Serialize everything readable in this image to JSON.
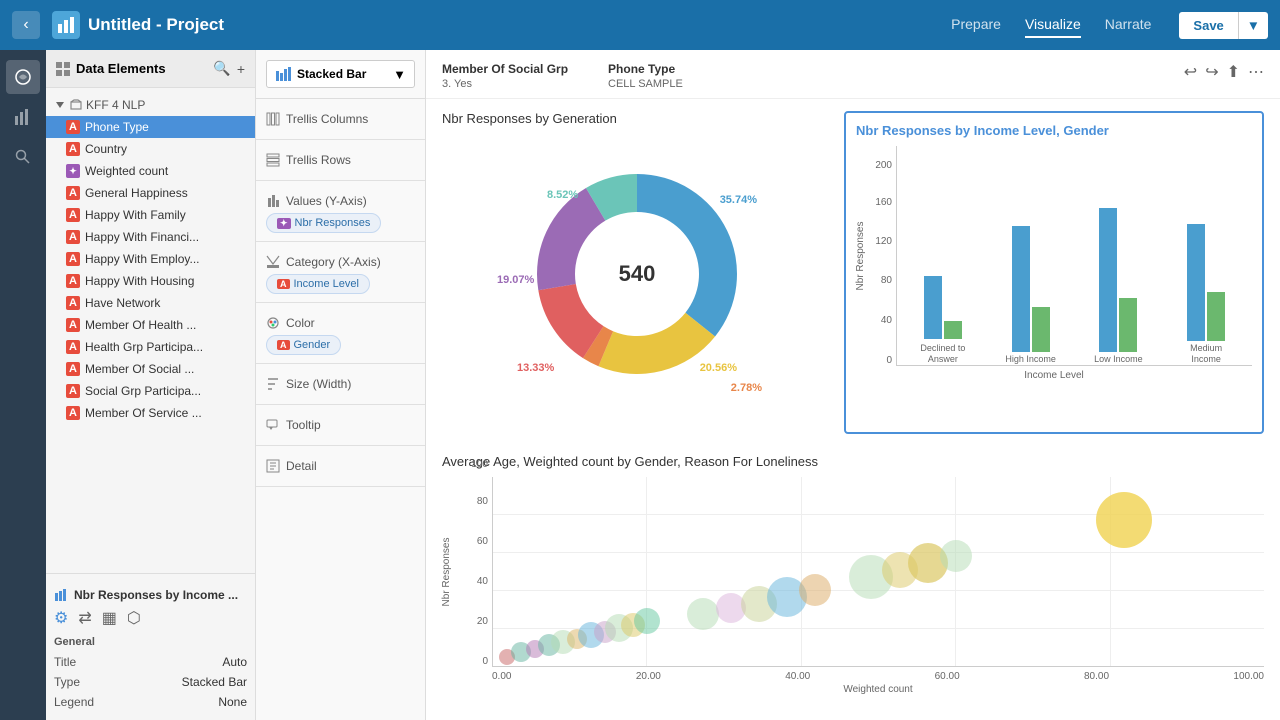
{
  "topNav": {
    "title": "Untitled - Project",
    "tabs": [
      {
        "label": "Prepare",
        "active": false
      },
      {
        "label": "Visualize",
        "active": true
      },
      {
        "label": "Narrate",
        "active": false
      }
    ],
    "saveLabel": "Save"
  },
  "dataPanel": {
    "title": "Data Elements",
    "projectName": "KFF 4 NLP",
    "items": [
      {
        "label": "Phone Type",
        "icon": "A",
        "selected": true
      },
      {
        "label": "Country",
        "icon": "A",
        "selected": false
      },
      {
        "label": "Weighted count",
        "icon": "hash",
        "selected": false
      },
      {
        "label": "General Happiness",
        "icon": "A",
        "selected": false
      },
      {
        "label": "Happy With Family",
        "icon": "A",
        "selected": false
      },
      {
        "label": "Happy With Financi...",
        "icon": "A",
        "selected": false
      },
      {
        "label": "Happy With Employ...",
        "icon": "A",
        "selected": false
      },
      {
        "label": "Happy With Housing",
        "icon": "A",
        "selected": false
      },
      {
        "label": "Have Network",
        "icon": "A",
        "selected": false
      },
      {
        "label": "Member Of Health ...",
        "icon": "A",
        "selected": false
      },
      {
        "label": "Health Grp Participa...",
        "icon": "A",
        "selected": false
      },
      {
        "label": "Member Of Social ...",
        "icon": "A",
        "selected": false
      },
      {
        "label": "Social Grp Participa...",
        "icon": "A",
        "selected": false
      },
      {
        "label": "Member Of Service ...",
        "icon": "A",
        "selected": false
      }
    ]
  },
  "vizConfig": {
    "title": "Nbr Responses by Income ...",
    "tabs": [
      "gear",
      "branch",
      "grid",
      "person"
    ],
    "section": "General",
    "props": [
      {
        "label": "Title",
        "value": "Auto"
      },
      {
        "label": "Type",
        "value": "Stacked Bar"
      },
      {
        "label": "Legend",
        "value": "None"
      }
    ]
  },
  "chartConfig": {
    "selectedType": "Stacked Bar",
    "sections": [
      {
        "label": "Trellis Columns",
        "icon": "trellis-columns"
      },
      {
        "label": "Trellis Rows",
        "icon": "trellis-rows"
      },
      {
        "label": "Values (Y-Axis)",
        "icon": "values-y",
        "chips": [
          {
            "label": "Nbr Responses",
            "icon": "hash"
          }
        ]
      },
      {
        "label": "Category (X-Axis)",
        "icon": "category-x",
        "chips": [
          {
            "label": "Income Level",
            "icon": "A"
          }
        ]
      },
      {
        "label": "Color",
        "icon": "color",
        "chips": [
          {
            "label": "Gender",
            "icon": "A"
          }
        ]
      },
      {
        "label": "Size (Width)",
        "icon": "size"
      },
      {
        "label": "Tooltip",
        "icon": "tooltip"
      },
      {
        "label": "Detail",
        "icon": "detail"
      }
    ]
  },
  "contentHeader": {
    "field1Label": "Member Of Social Grp",
    "field1Value": "3. Yes",
    "field2Label": "Phone Type",
    "field2Value": "CELL SAMPLE"
  },
  "pieChart": {
    "title": "Nbr Responses by Generation",
    "centerValue": "540",
    "segments": [
      {
        "label": "35.74%",
        "color": "#4a9ecf",
        "percent": 35.74
      },
      {
        "label": "20.56%",
        "color": "#e8c440",
        "percent": 20.56
      },
      {
        "label": "2.78%",
        "color": "#e8864a",
        "percent": 2.78
      },
      {
        "label": "13.33%",
        "color": "#e06060",
        "percent": 13.33
      },
      {
        "label": "19.07%",
        "color": "#9b6bb5",
        "percent": 19.07
      },
      {
        "label": "8.52%",
        "color": "#6bc5b8",
        "percent": 8.52
      }
    ]
  },
  "barChart": {
    "title": "Nbr Responses by Income Level, Gender",
    "yAxisLabel": "Nbr Responses",
    "xAxisLabel": "Income Level",
    "yMax": 200,
    "yTicks": [
      0,
      40,
      80,
      120,
      160,
      200
    ],
    "groups": [
      {
        "label": "Declined to Answer",
        "barA": 70,
        "barB": 20,
        "colorA": "#4a9ecf",
        "colorB": "#6bb86e"
      },
      {
        "label": "High Income",
        "barA": 140,
        "barB": 50,
        "colorA": "#4a9ecf",
        "colorB": "#6bb86e"
      },
      {
        "label": "Low Income",
        "barA": 160,
        "barB": 60,
        "colorA": "#4a9ecf",
        "colorB": "#6bb86e"
      },
      {
        "label": "Medium Income",
        "barA": 130,
        "barB": 55,
        "colorA": "#4a9ecf",
        "colorB": "#6bb86e"
      }
    ]
  },
  "scatterChart": {
    "title": "Average Age, Weighted count by Gender, Reason For Loneliness",
    "xAxisLabel": "Weighted count",
    "yAxisLabel": "Nbr Responses",
    "xTicks": [
      "0.00",
      "20.00",
      "40.00",
      "60.00",
      "80.00",
      "100.00"
    ],
    "yTicks": [
      "0",
      "20",
      "40",
      "60",
      "80",
      "100"
    ],
    "bubbles": [
      {
        "x": 2,
        "y": 5,
        "r": 8,
        "color": "rgba(200,100,100,0.5)"
      },
      {
        "x": 4,
        "y": 8,
        "r": 10,
        "color": "rgba(100,180,160,0.5)"
      },
      {
        "x": 6,
        "y": 10,
        "r": 9,
        "color": "rgba(180,120,180,0.5)"
      },
      {
        "x": 8,
        "y": 12,
        "r": 11,
        "color": "rgba(100,180,160,0.5)"
      },
      {
        "x": 10,
        "y": 14,
        "r": 12,
        "color": "rgba(180,220,180,0.5)"
      },
      {
        "x": 12,
        "y": 16,
        "r": 10,
        "color": "rgba(220,180,100,0.5)"
      },
      {
        "x": 14,
        "y": 18,
        "r": 13,
        "color": "rgba(100,180,220,0.5)"
      },
      {
        "x": 16,
        "y": 20,
        "r": 11,
        "color": "rgba(200,160,200,0.5)"
      },
      {
        "x": 18,
        "y": 22,
        "r": 14,
        "color": "rgba(180,220,180,0.5)"
      },
      {
        "x": 20,
        "y": 24,
        "r": 12,
        "color": "rgba(220,200,100,0.5)"
      },
      {
        "x": 22,
        "y": 26,
        "r": 13,
        "color": "rgba(100,200,160,0.5)"
      },
      {
        "x": 30,
        "y": 30,
        "r": 16,
        "color": "rgba(180,220,180,0.5)"
      },
      {
        "x": 34,
        "y": 34,
        "r": 15,
        "color": "rgba(220,180,220,0.5)"
      },
      {
        "x": 38,
        "y": 36,
        "r": 18,
        "color": "rgba(200,210,150,0.5)"
      },
      {
        "x": 42,
        "y": 40,
        "r": 20,
        "color": "rgba(100,180,220,0.5)"
      },
      {
        "x": 46,
        "y": 44,
        "r": 16,
        "color": "rgba(220,170,100,0.5)"
      },
      {
        "x": 54,
        "y": 52,
        "r": 22,
        "color": "rgba(180,220,180,0.5)"
      },
      {
        "x": 58,
        "y": 56,
        "r": 18,
        "color": "rgba(220,200,100,0.5)"
      },
      {
        "x": 62,
        "y": 60,
        "r": 20,
        "color": "rgba(220,200,100,0.7)"
      },
      {
        "x": 66,
        "y": 64,
        "r": 16,
        "color": "rgba(180,220,180,0.5)"
      },
      {
        "x": 90,
        "y": 85,
        "r": 28,
        "color": "rgba(240,210,80,0.8)"
      }
    ]
  }
}
